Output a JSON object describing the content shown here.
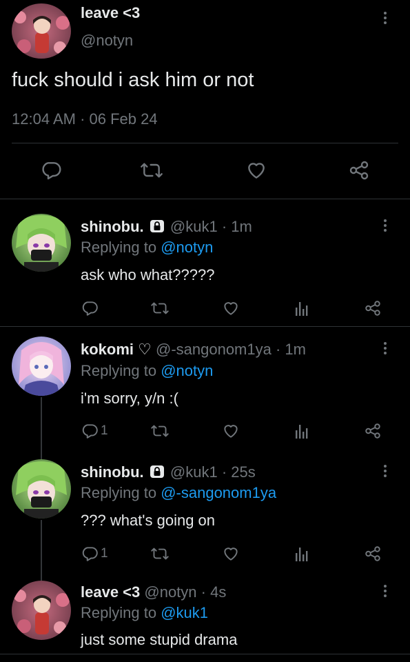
{
  "main_tweet": {
    "author_name": "leave <3",
    "author_handle": "@notyn",
    "text": "fuck should i ask him or not",
    "timestamp": "12:04 AM · 06 Feb 24"
  },
  "replies": [
    {
      "author_name": "shinobu.",
      "locked": true,
      "author_handle": "@kuk1",
      "time": "· 1m",
      "replying_prefix": "Replying to",
      "replying_to": "@notyn",
      "text": "ask who what?????",
      "reply_count": ""
    },
    {
      "author_name": "kokomi ♡",
      "locked": false,
      "author_handle": "@-sangonom1ya",
      "time": "· 1m",
      "replying_prefix": "Replying to",
      "replying_to": "@notyn",
      "text": "i'm sorry, y/n :(",
      "reply_count": "1"
    },
    {
      "author_name": "shinobu.",
      "locked": true,
      "author_handle": "@kuk1",
      "time": "· 25s",
      "replying_prefix": "Replying to",
      "replying_to": "@-sangonom1ya",
      "text": "??? what's going on",
      "reply_count": "1"
    },
    {
      "author_name": "leave <3",
      "locked": false,
      "author_handle": "@notyn",
      "time": "· 4s",
      "replying_prefix": "Replying to",
      "replying_to": "@kuk1",
      "text": "just some stupid drama",
      "reply_count": ""
    }
  ],
  "icons": {
    "reply": "reply-bubble-icon",
    "retweet": "retweet-icon",
    "like": "heart-icon",
    "views": "views-bar-icon",
    "share": "share-icon",
    "more": "more-vertical-icon",
    "lock": "lock-icon"
  },
  "colors": {
    "background": "#000000",
    "text": "#e7e9ea",
    "secondary": "#71767b",
    "link": "#1d9bf0",
    "divider": "#2f3336"
  }
}
